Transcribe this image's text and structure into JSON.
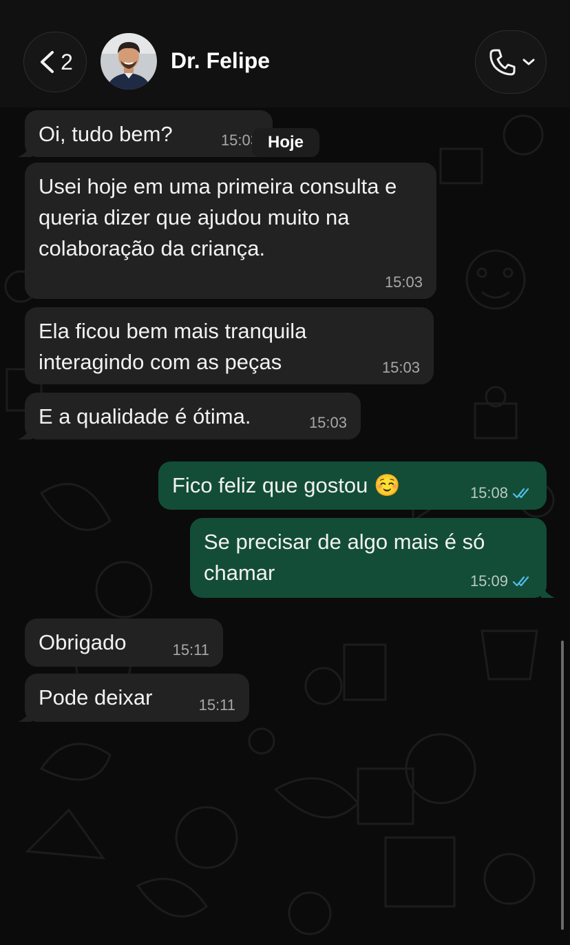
{
  "header": {
    "back_count": "2",
    "contact_name": "Dr. Felipe",
    "back_icon": "chevron-left-icon",
    "call_icon": "phone-icon",
    "call_menu_icon": "chevron-down-icon"
  },
  "date_chip": "Hoje",
  "messages": [
    {
      "direction": "in",
      "text": "Oi, tudo bem?",
      "time": "15:03"
    },
    {
      "direction": "in",
      "text": "Usei hoje em uma primeira consulta e queria dizer que ajudou muito na colaboração da criança.",
      "time": "15:03"
    },
    {
      "direction": "in",
      "text": "Ela ficou bem mais tranquila interagindo com as peças",
      "time": "15:03"
    },
    {
      "direction": "in",
      "text": "E a qualidade é ótima.",
      "time": "15:03"
    },
    {
      "direction": "out",
      "text": "Fico feliz que gostou ☺️",
      "time": "15:08",
      "status": "read"
    },
    {
      "direction": "out",
      "text": "Se precisar de algo mais é só chamar",
      "time": "15:09",
      "status": "read"
    },
    {
      "direction": "in",
      "text": "Obrigado",
      "time": "15:11"
    },
    {
      "direction": "in",
      "text": "Pode deixar",
      "time": "15:11"
    }
  ],
  "colors": {
    "incoming_bubble": "#222222",
    "outgoing_bubble": "#134d37",
    "read_ticks": "#53bdeb",
    "background": "#0b0b0b"
  }
}
